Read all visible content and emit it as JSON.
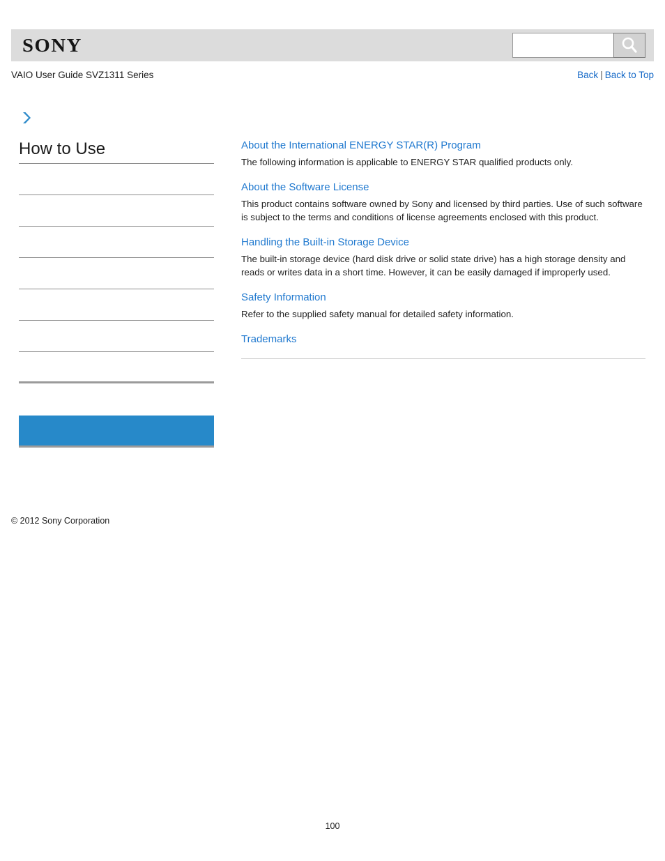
{
  "header": {
    "logo_text": "SONY",
    "logo_icon": "sony-logo",
    "search": {
      "value": "",
      "placeholder": "",
      "button_icon": "search-icon"
    }
  },
  "titlebar": {
    "guide_title": "VAIO User Guide SVZ1311 Series",
    "back_label": "Back",
    "separator": "|",
    "back_to_top_label": "Back to Top"
  },
  "sidebar": {
    "arrow_icon": "chevron-right-icon",
    "heading": "How to Use",
    "items": [
      {
        "label": "",
        "style": "normal"
      },
      {
        "label": "",
        "style": "normal"
      },
      {
        "label": "",
        "style": "normal"
      },
      {
        "label": "",
        "style": "normal"
      },
      {
        "label": "",
        "style": "normal"
      },
      {
        "label": "",
        "style": "normal"
      },
      {
        "label": "",
        "style": "thick"
      },
      {
        "label": "",
        "style": "highlight"
      }
    ],
    "copyright": "© 2012 Sony Corporation"
  },
  "content": {
    "entries": [
      {
        "title": "About the International ENERGY STAR(R) Program",
        "description": "The following information is applicable to ENERGY STAR qualified products only."
      },
      {
        "title": "About the Software License",
        "description": "This product contains software owned by Sony and licensed by third parties. Use of such software is subject to the terms and conditions of license agreements enclosed with this product."
      },
      {
        "title": "Handling the Built-in Storage Device",
        "description": "The built-in storage device (hard disk drive or solid state drive) has a high storage density and reads or writes data in a short time. However, it can be easily damaged if improperly used."
      },
      {
        "title": "Safety Information",
        "description": "Refer to the supplied safety manual for detailed safety information."
      },
      {
        "title": "Trademarks",
        "description": ""
      }
    ]
  },
  "footer": {
    "page_number": "100"
  },
  "colors": {
    "link_blue": "#2079cf",
    "nav_link_blue": "#1569c7",
    "highlight_blue": "#2789c9",
    "masthead_grey": "#dcdcdc",
    "rule_grey": "#8c8c8c"
  }
}
